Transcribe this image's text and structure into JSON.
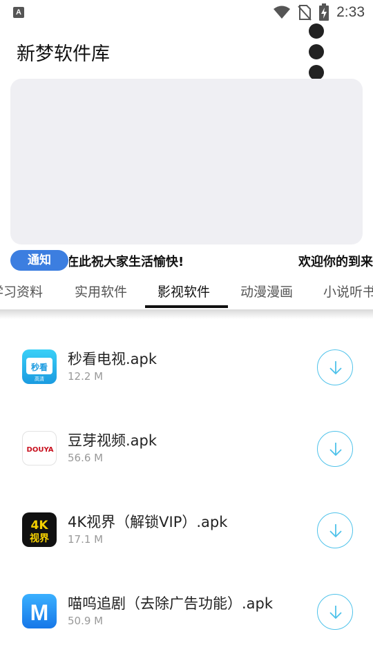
{
  "status_bar": {
    "indicator": "A",
    "time": "2:33",
    "icons": [
      "wifi-icon",
      "no-sim-icon",
      "battery-charging-icon"
    ]
  },
  "header": {
    "title": "新梦软件库"
  },
  "notice": {
    "badge": "通知",
    "messages": [
      "在此祝大家生活愉快!",
      "欢迎你的到来"
    ]
  },
  "tabs": [
    {
      "label": "学习资料"
    },
    {
      "label": "实用软件"
    },
    {
      "label": "影视软件",
      "active": true
    },
    {
      "label": "动漫漫画"
    },
    {
      "label": "小说听书"
    }
  ],
  "apps": [
    {
      "name": "秒看电视.apk",
      "size": "12.2 M",
      "icon_text": "秒看",
      "icon_sub": "高清",
      "icon": "miaokan-tv-icon"
    },
    {
      "name": "豆芽视频.apk",
      "size": "56.6 M",
      "icon_text": "DOUYA",
      "icon": "douya-video-icon"
    },
    {
      "name": "4K视界（解锁VIP）.apk",
      "size": "17.1 M",
      "icon_text": "4K",
      "icon_sub": "视界",
      "icon": "4k-vision-icon"
    },
    {
      "name": "喵呜追剧（去除广告功能）.apk",
      "size": "50.9 M",
      "icon_text": "M",
      "icon": "miaowu-icon"
    }
  ],
  "colors": {
    "accent": "#3c7ee0",
    "download_ring": "#4ec2ea",
    "banner_bg": "#efeff3"
  }
}
